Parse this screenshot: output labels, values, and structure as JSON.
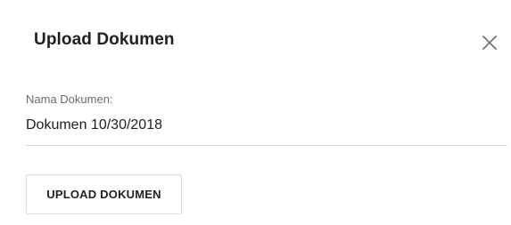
{
  "dialog": {
    "title": "Upload Dokumen",
    "close_icon": "close-icon"
  },
  "form": {
    "document_name_label": "Nama Dokumen:",
    "document_name_value": "Dokumen 10/30/2018"
  },
  "actions": {
    "upload_label": "UPLOAD DOKUMEN"
  }
}
